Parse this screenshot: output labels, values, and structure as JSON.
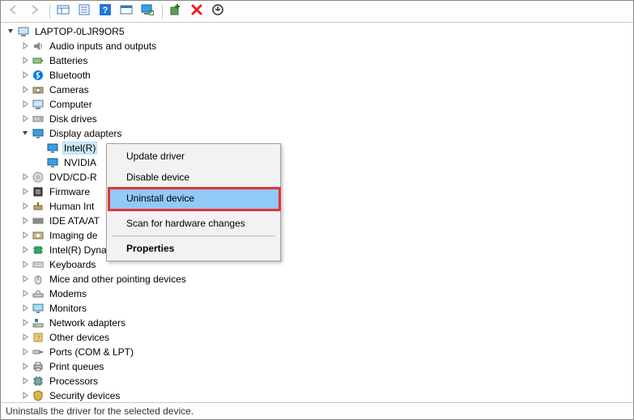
{
  "toolbar": {
    "buttons": [
      {
        "name": "back-button",
        "icon": "arrow-left-icon",
        "enabled": false
      },
      {
        "name": "forward-button",
        "icon": "arrow-right-icon",
        "enabled": false
      },
      {
        "name": "show-hidden-devices-button",
        "icon": "show-hidden-icon",
        "enabled": true
      },
      {
        "name": "properties-button",
        "icon": "properties-icon",
        "enabled": true
      },
      {
        "name": "help-button",
        "icon": "help-icon",
        "enabled": true
      },
      {
        "name": "action-button",
        "icon": "action-icon",
        "enabled": true
      },
      {
        "name": "scan-hardware-button",
        "icon": "monitor-scan-icon",
        "enabled": true
      },
      {
        "name": "add-legacy-button",
        "icon": "add-legacy-icon",
        "enabled": true
      },
      {
        "name": "uninstall-button",
        "icon": "red-x-icon",
        "enabled": true
      },
      {
        "name": "update-driver-button",
        "icon": "update-driver-icon",
        "enabled": true
      }
    ],
    "separators_after": [
      1,
      6
    ]
  },
  "tree": {
    "root": {
      "label": "LAPTOP-0LJR9OR5",
      "icon": "computer-icon",
      "expanded": true
    },
    "nodes": [
      {
        "label": "Audio inputs and outputs",
        "icon": "audio-icon",
        "expanded": false,
        "depth": 1
      },
      {
        "label": "Batteries",
        "icon": "battery-icon",
        "expanded": false,
        "depth": 1
      },
      {
        "label": "Bluetooth",
        "icon": "bluetooth-icon",
        "expanded": false,
        "depth": 1
      },
      {
        "label": "Cameras",
        "icon": "camera-icon",
        "expanded": false,
        "depth": 1
      },
      {
        "label": "Computer",
        "icon": "computer-icon",
        "expanded": false,
        "depth": 1
      },
      {
        "label": "Disk drives",
        "icon": "disk-icon",
        "expanded": false,
        "depth": 1
      },
      {
        "label": "Display adapters",
        "icon": "display-icon",
        "expanded": true,
        "depth": 1
      },
      {
        "label": "Intel(R)",
        "icon": "display-icon",
        "leaf": true,
        "depth": 2,
        "selected": true
      },
      {
        "label": "NVIDIA",
        "icon": "display-icon",
        "leaf": true,
        "depth": 2
      },
      {
        "label": "DVD/CD-R",
        "icon": "dvd-icon",
        "expanded": false,
        "depth": 1
      },
      {
        "label": "Firmware",
        "icon": "firmware-icon",
        "expanded": false,
        "depth": 1
      },
      {
        "label": "Human Int",
        "icon": "hid-icon",
        "expanded": false,
        "depth": 1
      },
      {
        "label": "IDE ATA/AT",
        "icon": "ide-icon",
        "expanded": false,
        "depth": 1
      },
      {
        "label": "Imaging de",
        "icon": "imaging-icon",
        "expanded": false,
        "depth": 1
      },
      {
        "label": "Intel(R) Dynamic Platform and Thermal Framework",
        "icon": "chip-icon",
        "expanded": false,
        "depth": 1
      },
      {
        "label": "Keyboards",
        "icon": "keyboard-icon",
        "expanded": false,
        "depth": 1
      },
      {
        "label": "Mice and other pointing devices",
        "icon": "mouse-icon",
        "expanded": false,
        "depth": 1
      },
      {
        "label": "Modems",
        "icon": "modem-icon",
        "expanded": false,
        "depth": 1
      },
      {
        "label": "Monitors",
        "icon": "monitor-icon",
        "expanded": false,
        "depth": 1
      },
      {
        "label": "Network adapters",
        "icon": "network-icon",
        "expanded": false,
        "depth": 1
      },
      {
        "label": "Other devices",
        "icon": "other-icon",
        "expanded": false,
        "depth": 1
      },
      {
        "label": "Ports (COM & LPT)",
        "icon": "port-icon",
        "expanded": false,
        "depth": 1
      },
      {
        "label": "Print queues",
        "icon": "printer-icon",
        "expanded": false,
        "depth": 1
      },
      {
        "label": "Processors",
        "icon": "processor-icon",
        "expanded": false,
        "depth": 1
      },
      {
        "label": "Security devices",
        "icon": "security-icon",
        "expanded": false,
        "depth": 1
      }
    ]
  },
  "context_menu": {
    "items": [
      {
        "label": "Update driver",
        "type": "item"
      },
      {
        "label": "Disable device",
        "type": "item"
      },
      {
        "label": "Uninstall device",
        "type": "item",
        "hover": true,
        "highlighted_annotation": true
      },
      {
        "type": "separator"
      },
      {
        "label": "Scan for hardware changes",
        "type": "item"
      },
      {
        "type": "separator"
      },
      {
        "label": "Properties",
        "type": "item",
        "bold": true
      }
    ]
  },
  "statusbar": {
    "text": "Uninstalls the driver for the selected device."
  },
  "colors": {
    "selection_bg": "#cce8ff",
    "menu_hover_bg": "#91c9f7",
    "annotation_red": "#e53237",
    "bluetooth_blue": "#0078d7"
  }
}
